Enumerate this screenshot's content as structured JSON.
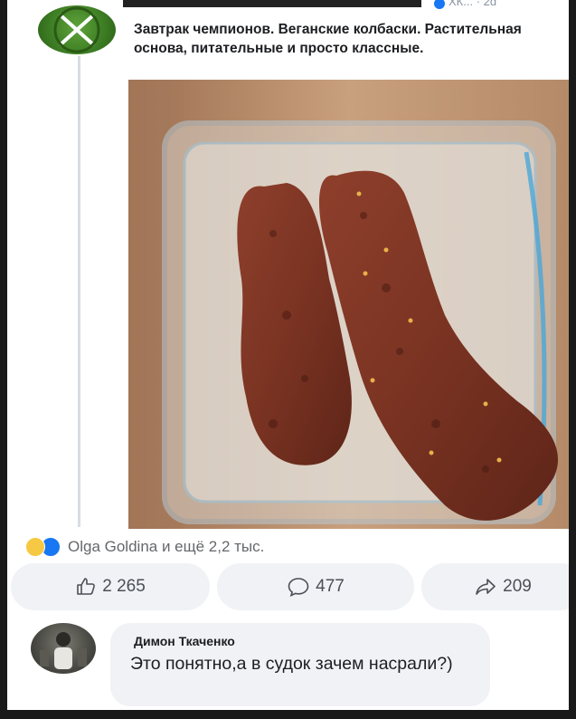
{
  "post": {
    "text": "Завтрак чемпионов. Веганские колбаски. Растительная основа, питательные и просто классные.",
    "header_meta": "ХК... · 2d",
    "image_alt": "Две коричневые веганские колбаски в стеклянном контейнере"
  },
  "reactions": {
    "summary": "Olga Goldina и ещё 2,2 тыс.",
    "icons": [
      "haha-icon",
      "like-icon"
    ]
  },
  "actions": {
    "likes": "2 265",
    "comments": "477",
    "shares": "209"
  },
  "comment": {
    "author": "Димон Ткаченко",
    "text": "Это понятно,а в судок зачем насрали?)"
  },
  "colors": {
    "accent": "#1877f2",
    "avatar_green": "#4a8f2c",
    "bubble": "#f0f2f5"
  }
}
